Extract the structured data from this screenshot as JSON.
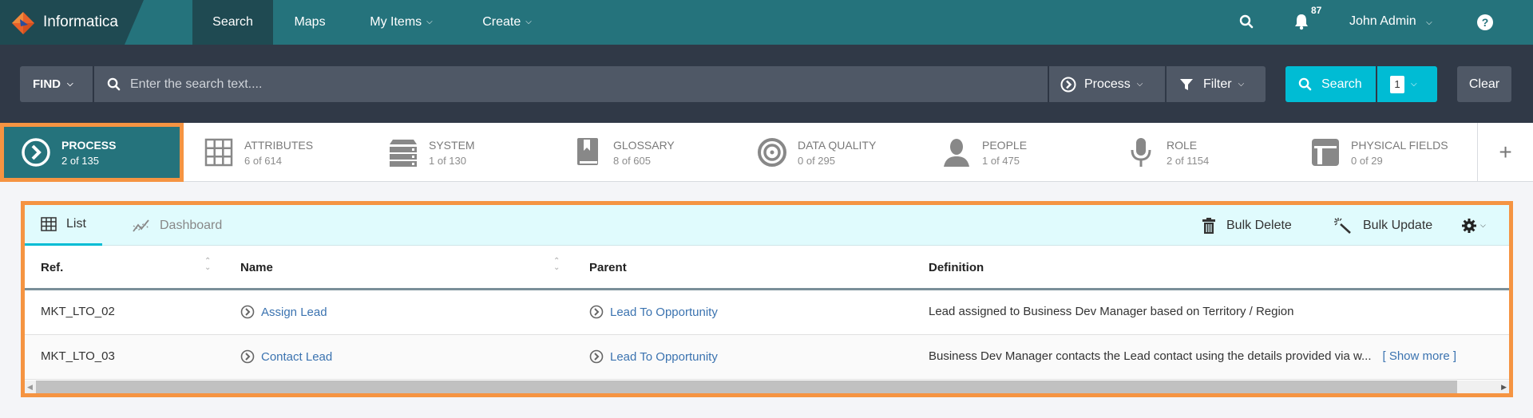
{
  "topbar": {
    "brand": "Informatica",
    "nav": [
      {
        "label": "Search",
        "active": true
      },
      {
        "label": "Maps",
        "active": false
      },
      {
        "label": "My Items",
        "has_dropdown": true
      },
      {
        "label": "Create",
        "has_dropdown": true
      }
    ],
    "notifications_count": "87",
    "user": "John Admin",
    "icons": [
      "search-icon",
      "bell-icon",
      "help-icon"
    ]
  },
  "search": {
    "find_label": "FIND",
    "placeholder": "Enter the search text....",
    "value": "",
    "type_filter": "Process",
    "filter_label": "Filter",
    "search_label": "Search",
    "count": "1",
    "clear_label": "Clear"
  },
  "categories": [
    {
      "title": "PROCESS",
      "count": "2 of 135",
      "icon": "process-icon",
      "active": true
    },
    {
      "title": "ATTRIBUTES",
      "count": "6 of 614",
      "icon": "grid-icon"
    },
    {
      "title": "SYSTEM",
      "count": "1 of 130",
      "icon": "server-icon"
    },
    {
      "title": "GLOSSARY",
      "count": "8 of 605",
      "icon": "book-icon"
    },
    {
      "title": "DATA QUALITY",
      "count": "0 of 295",
      "icon": "target-icon"
    },
    {
      "title": "PEOPLE",
      "count": "1 of 475",
      "icon": "person-icon"
    },
    {
      "title": "ROLE",
      "count": "2 of 1154",
      "icon": "microphone-icon"
    },
    {
      "title": "PHYSICAL FIELDS",
      "count": "0 of 29",
      "icon": "table-icon"
    }
  ],
  "results": {
    "tabs": [
      {
        "label": "List",
        "active": true
      },
      {
        "label": "Dashboard",
        "active": false
      }
    ],
    "actions": {
      "bulk_delete": "Bulk Delete",
      "bulk_update": "Bulk Update"
    },
    "columns": [
      "Ref.",
      "Name",
      "Parent",
      "Definition"
    ],
    "rows": [
      {
        "ref": "MKT_LTO_02",
        "name": "Assign Lead",
        "parent": "Lead To Opportunity",
        "definition": "Lead assigned to Business Dev Manager based on Territory / Region",
        "show_more": ""
      },
      {
        "ref": "MKT_LTO_03",
        "name": "Contact Lead",
        "parent": "Lead To Opportunity",
        "definition": "Business Dev Manager contacts the Lead contact using the details provided via w...",
        "show_more": "[ Show more ]"
      }
    ]
  },
  "colors": {
    "topbar": "#25737c",
    "searchbar": "#303947",
    "accent": "#00bcd4",
    "highlight_border": "#f59442",
    "link": "#3b73b0"
  }
}
